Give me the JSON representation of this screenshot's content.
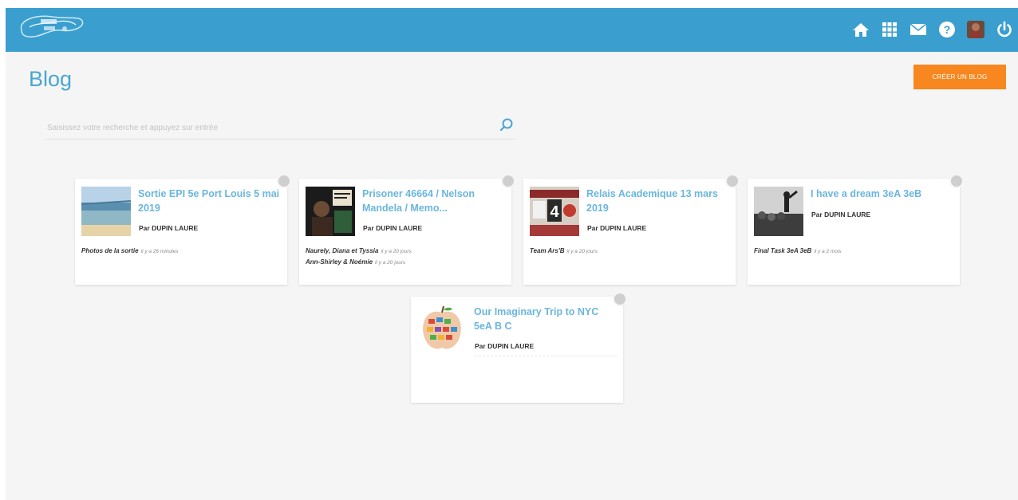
{
  "header": {
    "logo_alt": "logo",
    "icons": [
      "home-icon",
      "apps-grid-icon",
      "mail-icon",
      "help-icon",
      "avatar",
      "power-icon"
    ]
  },
  "page": {
    "title": "Blog",
    "create_button": "CRÉER UN BLOG"
  },
  "search": {
    "placeholder": "Saisissez votre recherche et appuyez sur entrée"
  },
  "cards": [
    {
      "title": "Sortie EPI 5e Port Louis 5 mai 2019",
      "author": "Par DUPIN LAURE",
      "posts": [
        {
          "title": "Photos de la sortie",
          "date": "il y a 26 minutes"
        }
      ]
    },
    {
      "title": "Prisoner 46664 / Nelson Mandela / Memo...",
      "author": "Par DUPIN LAURE",
      "posts": [
        {
          "title": "Naurely, Diana et Tyssia",
          "date": "il y a 20 jours"
        },
        {
          "title": "Ann-Shirley & Noémie",
          "date": "il y a 20 jours"
        }
      ]
    },
    {
      "title": "Relais Academique 13 mars 2019",
      "author": "Par DUPIN LAURE",
      "posts": [
        {
          "title": "Team Ars'B",
          "date": "il y a 20 jours"
        }
      ]
    },
    {
      "title": "I have a dream 3eA 3eB",
      "author": "Par DUPIN LAURE",
      "posts": [
        {
          "title": "Final Task 3eA 3eB",
          "date": "il y a 2 mois"
        }
      ]
    },
    {
      "title": "Our Imaginary Trip to NYC 5eA B C",
      "author": "Par DUPIN LAURE",
      "posts": []
    }
  ],
  "colors": {
    "header": "#3a9fcf",
    "accent": "#f7871e",
    "title": "#4aa6d0",
    "link": "#6ab6dd"
  }
}
